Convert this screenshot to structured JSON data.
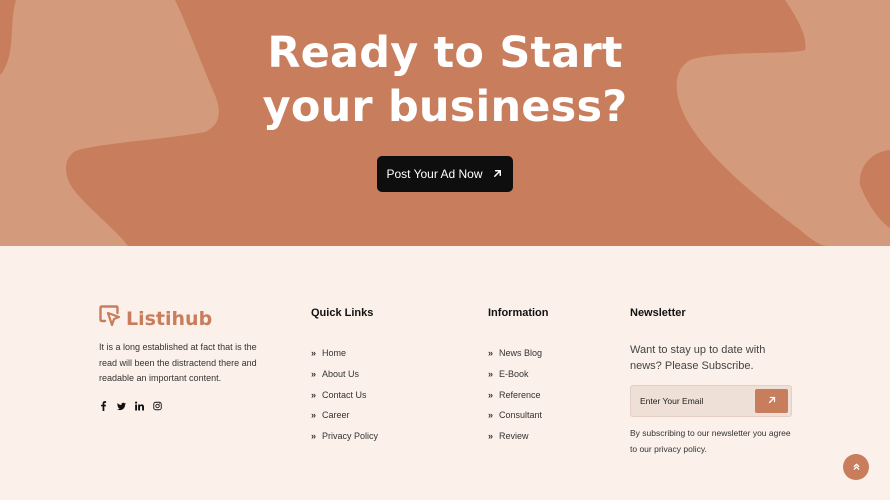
{
  "hero": {
    "title_line1": "Ready to Start",
    "title_line2": "your business?",
    "cta_label": "Post Your Ad Now",
    "cta_icon": "arrow-up-right-icon"
  },
  "colors": {
    "accent": "#c87d5c",
    "accent_light": "#d39a7c",
    "footer_bg": "#fbf0ea",
    "button_dark": "#0e0e0e"
  },
  "brand": {
    "name": "Listihub",
    "icon": "cursor-logo-icon",
    "description": "It is a long established at fact that is the read will been the distractend there and readable an important content."
  },
  "socials": [
    {
      "icon": "facebook-icon"
    },
    {
      "icon": "twitter-icon"
    },
    {
      "icon": "linkedin-icon"
    },
    {
      "icon": "instagram-icon"
    }
  ],
  "quick_links": {
    "title": "Quick Links",
    "items": [
      "Home",
      "About Us",
      "Contact Us",
      "Career",
      "Privacy Policy"
    ]
  },
  "information": {
    "title": "Information",
    "items": [
      "News Blog",
      "E-Book",
      "Reference",
      "Consultant",
      "Review"
    ]
  },
  "newsletter": {
    "title": "Newsletter",
    "text": "Want to stay up to date with news? Please Subscribe.",
    "placeholder": "Enter Your Email",
    "note": "By subscribing to our newsletter you agree to our privacy policy."
  },
  "scroll_top_icon": "double-chevron-up-icon"
}
